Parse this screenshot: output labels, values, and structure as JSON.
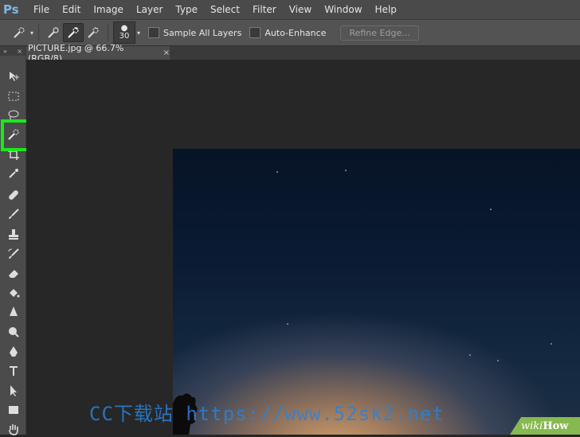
{
  "app": {
    "logo": "Ps"
  },
  "menu": [
    "File",
    "Edit",
    "Image",
    "Layer",
    "Type",
    "Select",
    "Filter",
    "View",
    "Window",
    "Help"
  ],
  "options": {
    "brush_size": "30",
    "sample_all_layers": "Sample All Layers",
    "auto_enhance": "Auto-Enhance",
    "refine_edge": "Refine Edge..."
  },
  "document_tab": {
    "title": "PICTURE.jpg @ 66.7% (RGB/8)",
    "close": "×"
  },
  "toolbar": {
    "collapse": "»",
    "close": "×"
  },
  "watermark": "CC下载站 https://www.52sk2.net",
  "badge": {
    "wiki": "wiki",
    "how": "How"
  },
  "colors": {
    "highlight": "#1ce81c",
    "menubar": "#4a4a4a",
    "canvas": "#272727",
    "accent_blue": "#7fb8e3"
  }
}
